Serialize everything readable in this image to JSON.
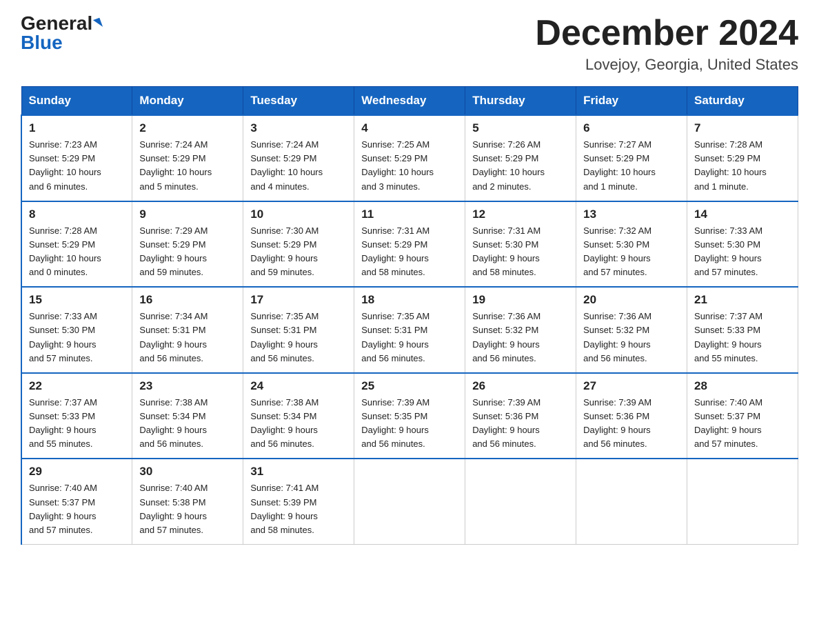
{
  "header": {
    "logo_general": "General",
    "logo_blue": "Blue",
    "month_title": "December 2024",
    "location": "Lovejoy, Georgia, United States"
  },
  "days_of_week": [
    "Sunday",
    "Monday",
    "Tuesday",
    "Wednesday",
    "Thursday",
    "Friday",
    "Saturday"
  ],
  "weeks": [
    [
      {
        "day": "1",
        "info": "Sunrise: 7:23 AM\nSunset: 5:29 PM\nDaylight: 10 hours\nand 6 minutes."
      },
      {
        "day": "2",
        "info": "Sunrise: 7:24 AM\nSunset: 5:29 PM\nDaylight: 10 hours\nand 5 minutes."
      },
      {
        "day": "3",
        "info": "Sunrise: 7:24 AM\nSunset: 5:29 PM\nDaylight: 10 hours\nand 4 minutes."
      },
      {
        "day": "4",
        "info": "Sunrise: 7:25 AM\nSunset: 5:29 PM\nDaylight: 10 hours\nand 3 minutes."
      },
      {
        "day": "5",
        "info": "Sunrise: 7:26 AM\nSunset: 5:29 PM\nDaylight: 10 hours\nand 2 minutes."
      },
      {
        "day": "6",
        "info": "Sunrise: 7:27 AM\nSunset: 5:29 PM\nDaylight: 10 hours\nand 1 minute."
      },
      {
        "day": "7",
        "info": "Sunrise: 7:28 AM\nSunset: 5:29 PM\nDaylight: 10 hours\nand 1 minute."
      }
    ],
    [
      {
        "day": "8",
        "info": "Sunrise: 7:28 AM\nSunset: 5:29 PM\nDaylight: 10 hours\nand 0 minutes."
      },
      {
        "day": "9",
        "info": "Sunrise: 7:29 AM\nSunset: 5:29 PM\nDaylight: 9 hours\nand 59 minutes."
      },
      {
        "day": "10",
        "info": "Sunrise: 7:30 AM\nSunset: 5:29 PM\nDaylight: 9 hours\nand 59 minutes."
      },
      {
        "day": "11",
        "info": "Sunrise: 7:31 AM\nSunset: 5:29 PM\nDaylight: 9 hours\nand 58 minutes."
      },
      {
        "day": "12",
        "info": "Sunrise: 7:31 AM\nSunset: 5:30 PM\nDaylight: 9 hours\nand 58 minutes."
      },
      {
        "day": "13",
        "info": "Sunrise: 7:32 AM\nSunset: 5:30 PM\nDaylight: 9 hours\nand 57 minutes."
      },
      {
        "day": "14",
        "info": "Sunrise: 7:33 AM\nSunset: 5:30 PM\nDaylight: 9 hours\nand 57 minutes."
      }
    ],
    [
      {
        "day": "15",
        "info": "Sunrise: 7:33 AM\nSunset: 5:30 PM\nDaylight: 9 hours\nand 57 minutes."
      },
      {
        "day": "16",
        "info": "Sunrise: 7:34 AM\nSunset: 5:31 PM\nDaylight: 9 hours\nand 56 minutes."
      },
      {
        "day": "17",
        "info": "Sunrise: 7:35 AM\nSunset: 5:31 PM\nDaylight: 9 hours\nand 56 minutes."
      },
      {
        "day": "18",
        "info": "Sunrise: 7:35 AM\nSunset: 5:31 PM\nDaylight: 9 hours\nand 56 minutes."
      },
      {
        "day": "19",
        "info": "Sunrise: 7:36 AM\nSunset: 5:32 PM\nDaylight: 9 hours\nand 56 minutes."
      },
      {
        "day": "20",
        "info": "Sunrise: 7:36 AM\nSunset: 5:32 PM\nDaylight: 9 hours\nand 56 minutes."
      },
      {
        "day": "21",
        "info": "Sunrise: 7:37 AM\nSunset: 5:33 PM\nDaylight: 9 hours\nand 55 minutes."
      }
    ],
    [
      {
        "day": "22",
        "info": "Sunrise: 7:37 AM\nSunset: 5:33 PM\nDaylight: 9 hours\nand 55 minutes."
      },
      {
        "day": "23",
        "info": "Sunrise: 7:38 AM\nSunset: 5:34 PM\nDaylight: 9 hours\nand 56 minutes."
      },
      {
        "day": "24",
        "info": "Sunrise: 7:38 AM\nSunset: 5:34 PM\nDaylight: 9 hours\nand 56 minutes."
      },
      {
        "day": "25",
        "info": "Sunrise: 7:39 AM\nSunset: 5:35 PM\nDaylight: 9 hours\nand 56 minutes."
      },
      {
        "day": "26",
        "info": "Sunrise: 7:39 AM\nSunset: 5:36 PM\nDaylight: 9 hours\nand 56 minutes."
      },
      {
        "day": "27",
        "info": "Sunrise: 7:39 AM\nSunset: 5:36 PM\nDaylight: 9 hours\nand 56 minutes."
      },
      {
        "day": "28",
        "info": "Sunrise: 7:40 AM\nSunset: 5:37 PM\nDaylight: 9 hours\nand 57 minutes."
      }
    ],
    [
      {
        "day": "29",
        "info": "Sunrise: 7:40 AM\nSunset: 5:37 PM\nDaylight: 9 hours\nand 57 minutes."
      },
      {
        "day": "30",
        "info": "Sunrise: 7:40 AM\nSunset: 5:38 PM\nDaylight: 9 hours\nand 57 minutes."
      },
      {
        "day": "31",
        "info": "Sunrise: 7:41 AM\nSunset: 5:39 PM\nDaylight: 9 hours\nand 58 minutes."
      },
      {
        "day": "",
        "info": ""
      },
      {
        "day": "",
        "info": ""
      },
      {
        "day": "",
        "info": ""
      },
      {
        "day": "",
        "info": ""
      }
    ]
  ]
}
